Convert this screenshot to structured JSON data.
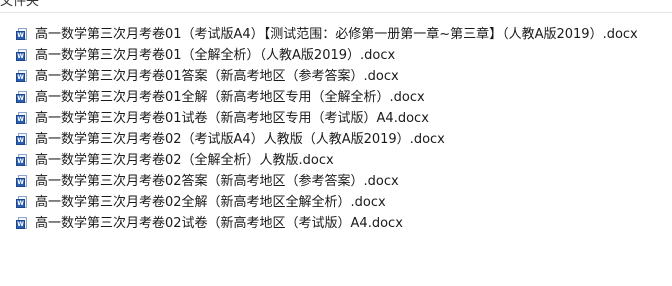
{
  "header": {
    "title": "文件夹"
  },
  "icon": {
    "type": "word-document-icon",
    "glyph": "W",
    "color": "#2b5fb4"
  },
  "files": [
    {
      "name": "高一数学第三次月考卷01（考试版A4）【测试范围：必修第一册第一章~第三章】（人教A版2019）.docx"
    },
    {
      "name": "高一数学第三次月考卷01（全解全析）（人教A版2019）.docx"
    },
    {
      "name": "高一数学第三次月考卷01答案（新高考地区（参考答案）.docx"
    },
    {
      "name": "高一数学第三次月考卷01全解（新高考地区专用（全解全析）.docx"
    },
    {
      "name": "高一数学第三次月考卷01试卷（新高考地区专用（考试版）A4.docx"
    },
    {
      "name": "高一数学第三次月考卷02（考试版A4）人教版（人教A版2019）.docx"
    },
    {
      "name": "高一数学第三次月考卷02（全解全析）人教版.docx"
    },
    {
      "name": "高一数学第三次月考卷02答案（新高考地区（参考答案）.docx"
    },
    {
      "name": "高一数学第三次月考卷02全解（新高考地区全解全析）.docx"
    },
    {
      "name": "高一数学第三次月考卷02试卷（新高考地区（考试版）A4.docx"
    }
  ]
}
